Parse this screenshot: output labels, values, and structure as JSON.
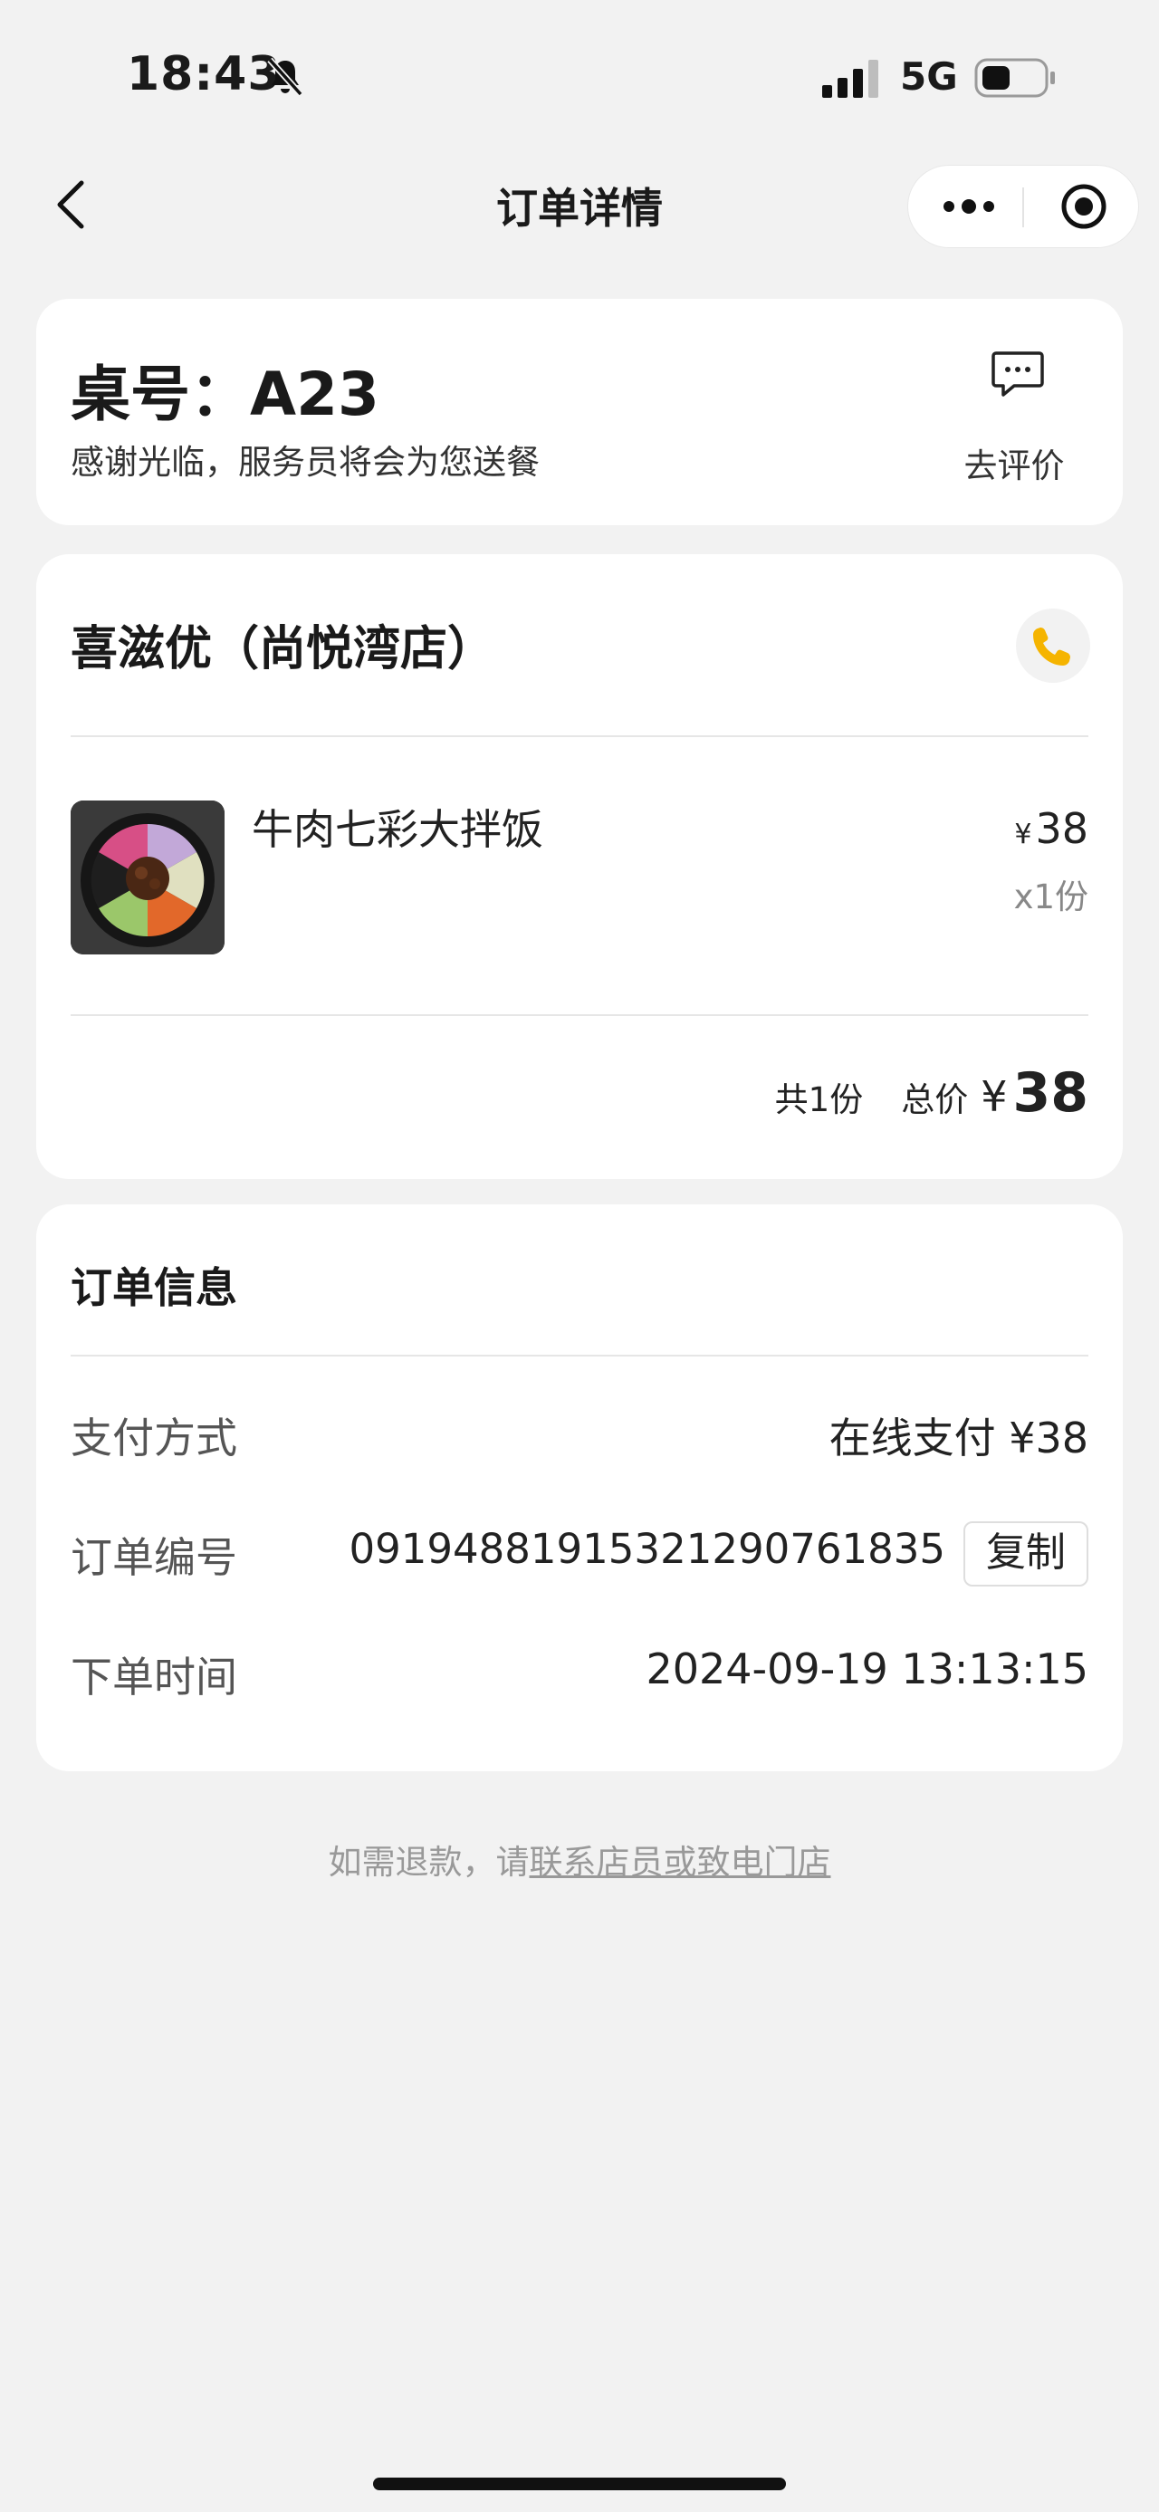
{
  "status_bar": {
    "time": "18:43",
    "network": "5G"
  },
  "nav": {
    "title": "订单详情"
  },
  "table_card": {
    "table_label": "桌号：",
    "table_number": "A23",
    "message": "感谢光临，服务员将会为您送餐",
    "review_label": "去评价"
  },
  "order_card": {
    "store_name": "喜滋优（尚悦湾店）",
    "items": [
      {
        "name": "牛肉七彩大拌饭",
        "currency": "¥",
        "price": "38",
        "quantity": "x1份"
      }
    ],
    "summary": {
      "count": "共1份",
      "total_label": "总价",
      "currency": "¥",
      "total": "38"
    }
  },
  "info_card": {
    "title": "订单信息",
    "rows": [
      {
        "label": "支付方式",
        "value": "在线支付 ¥38"
      },
      {
        "label": "订单编号",
        "value": "0919488191532129076183​5"
      },
      {
        "label": "下单时间",
        "value": "2024-09-19 13:13:15"
      }
    ],
    "copy_label": "复制"
  },
  "footnote": {
    "prefix": "如需退款，请",
    "link": "联系店员或致电门店"
  },
  "colors": {
    "accent_phone": "#f5b400",
    "background": "#f2f2f2",
    "card": "#ffffff"
  }
}
